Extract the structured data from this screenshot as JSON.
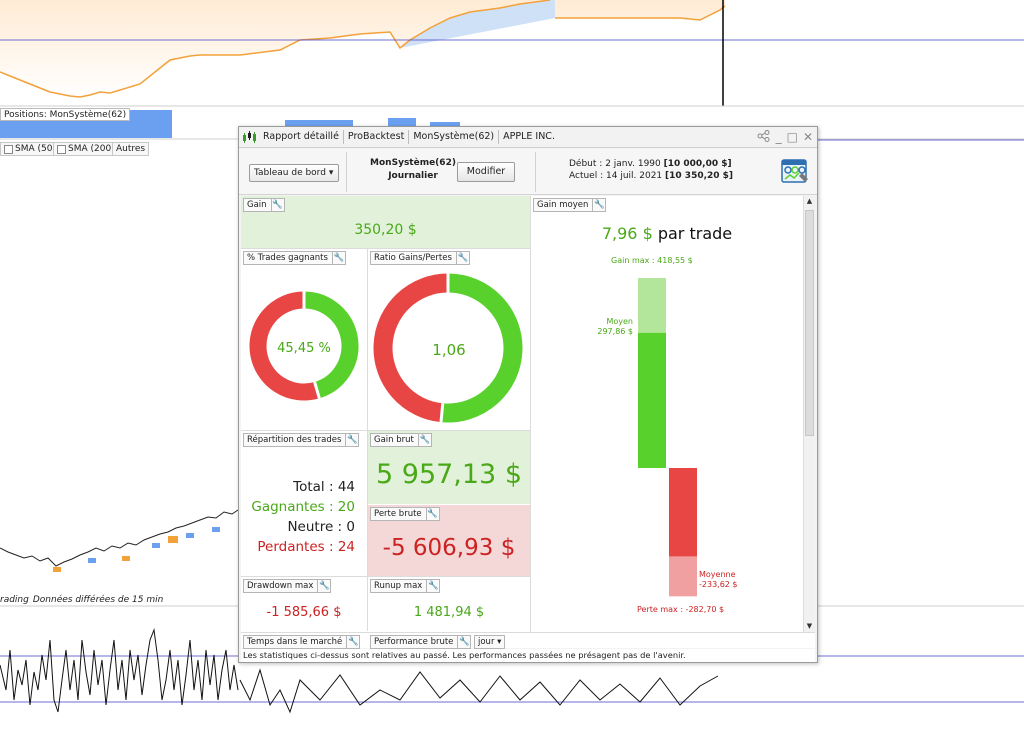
{
  "background": {
    "positions_label": "Positions: MonSystème(62)",
    "indicators": [
      {
        "label": "SMA (50)"
      },
      {
        "label": "SMA (200)"
      },
      {
        "label": "Autres"
      }
    ],
    "status_label_1": "rading",
    "status_label_2": "Données différées de 15 min"
  },
  "window": {
    "title_segments": [
      "Rapport détaillé",
      "ProBacktest",
      "MonSystème(62)",
      "APPLE INC."
    ],
    "controls": {
      "share": "share-icon",
      "minimize": "_",
      "maximize": "□",
      "close": "✕"
    },
    "toolbar": {
      "dashboard_select": "Tableau de bord",
      "system_name": "MonSystème(62)",
      "system_period": "Journalier",
      "modify_button": "Modifier",
      "start_label": "Début :",
      "start_date": "2 janv. 1990",
      "start_capital": "[10 000,00 $]",
      "current_label": "Actuel :",
      "current_date": "14 juil. 2021",
      "current_capital": "[10 350,20 $]"
    },
    "cards": {
      "gain": {
        "title": "Gain",
        "value": "350,20 $"
      },
      "win_rate": {
        "title": "% Trades gagnants",
        "value": "45,45 %",
        "fraction": 0.4545
      },
      "ratio": {
        "title": "Ratio Gains/Pertes",
        "value": "1,06",
        "fraction": 0.515
      },
      "distribution": {
        "title": "Répartition des trades",
        "total": "Total : 44",
        "winners": "Gagnantes : 20",
        "neutral": "Neutre : 0",
        "losers": "Perdantes : 24"
      },
      "gross_gain": {
        "title": "Gain brut",
        "value": "5 957,13 $"
      },
      "gross_loss": {
        "title": "Perte brute",
        "value": "-5 606,93 $"
      },
      "drawdown": {
        "title": "Drawdown max",
        "value": "-1 585,66 $"
      },
      "runup": {
        "title": "Runup max",
        "value": "1 481,94 $"
      },
      "avg_gain": {
        "title": "Gain moyen",
        "value_amount": "7,96 $",
        "value_suffix": "par trade",
        "max_gain_label": "Gain max : 418,55 $",
        "avg_label": "Moyen",
        "avg_value": "297,86 $",
        "avg_loss_label": "Moyenne",
        "avg_loss_value": "-233,62 $",
        "max_loss_label": "Perte max : -282,70 $",
        "max_gain": 418.55,
        "avg_win": 297.86,
        "avg_loss": 233.62,
        "max_loss": 282.7
      }
    },
    "bottom": {
      "market_time": "Temps dans le marché",
      "gross_performance": "Performance brute",
      "period_select": "jour"
    },
    "disclaimer": "Les statistiques ci-dessus sont relatives au passé. Les performances passées ne présagent pas de l'avenir."
  },
  "colors": {
    "green": "#59d12d",
    "green_light": "#b3e59a",
    "red": "#e84545",
    "red_light": "#f0a0a0",
    "green_text": "#4aa819",
    "red_text": "#cc2222"
  }
}
